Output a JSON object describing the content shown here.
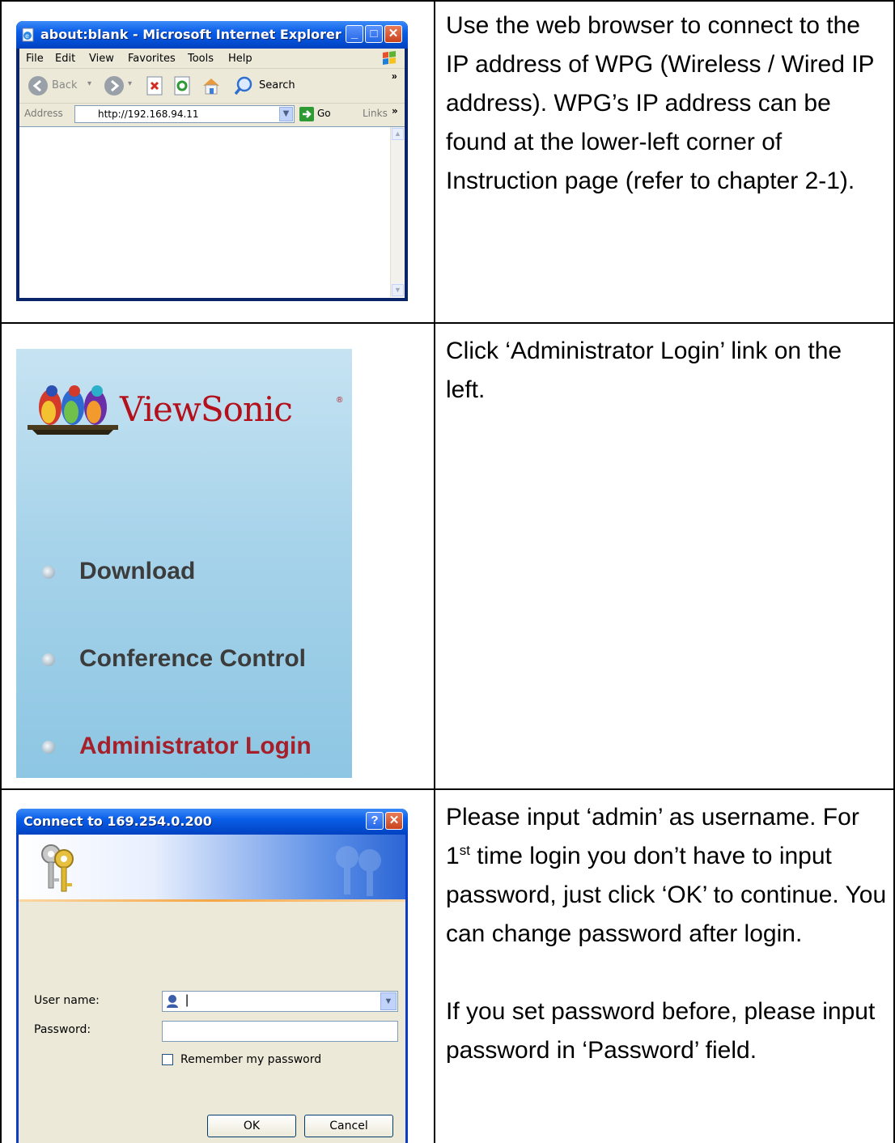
{
  "rows": [
    {
      "browser": {
        "title": "about:blank - Microsoft Internet Explorer",
        "menu": [
          "File",
          "Edit",
          "View",
          "Favorites",
          "Tools",
          "Help"
        ],
        "back_label": "Back",
        "search_label": "Search",
        "address_label": "Address",
        "address_value": "http://192.168.94.11",
        "go_label": "Go",
        "links_label": "Links"
      },
      "text": "Use the web browser to connect to the IP address of WPG (Wireless / Wired IP address). WPG’s IP address can be found at the lower-left corner of Instruction page (refer to chapter 2-1)."
    },
    {
      "panel": {
        "logo_text": "ViewSonic",
        "menu": [
          "Download",
          "Conference Control",
          "Administrator Login"
        ]
      },
      "text": "Click ‘Administrator Login’ link on the left."
    },
    {
      "dialog": {
        "title": "Connect to 169.254.0.200",
        "username_label": "User name:",
        "username_value": "|",
        "password_label": "Password:",
        "remember_label": "Remember my password",
        "ok_label": "OK",
        "cancel_label": "Cancel"
      },
      "text_a": "Please input ‘admin’ as username. For",
      "text_b_num": "1",
      "text_b_sup": "st",
      "text_b_rest": " time login you don’t have to input password, just click ‘OK’ to continue. You can change password after login.",
      "text_c": "If you set password before, please input password in ‘Password’ field."
    }
  ],
  "colors": {
    "xp_titlebar": "#0a5ee8",
    "viewsonic_red": "#b4101b",
    "admin_login_red": "#a6202b",
    "panel_blue": "#a7d3ea"
  }
}
